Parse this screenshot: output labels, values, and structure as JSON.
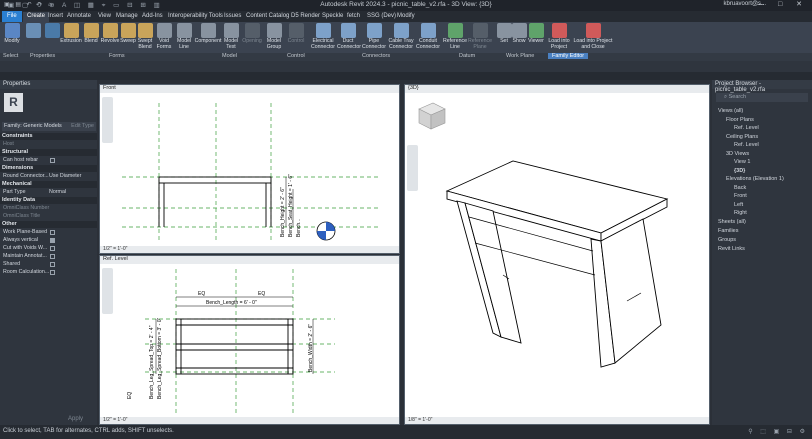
{
  "window": {
    "title": "Autodesk Revit 2024.3 - picnic_table_v2.rfa - 3D View: {3D}",
    "user": "kbruavoort@s...",
    "controls": "— □ ✕"
  },
  "tabs": [
    "File",
    "Create",
    "Insert",
    "Annotate",
    "View",
    "Manage",
    "Add-Ins",
    "Interoperability Tools",
    "Issues",
    "Content Catalog",
    "D5 Render",
    "Speckle",
    "fetch",
    "SSG (Dev)",
    "Modify"
  ],
  "ribbon": {
    "buttons": [
      "Modify",
      "Family Types",
      "Extrusion",
      "Blend",
      "Revolve",
      "Sweep",
      "Swept Blend",
      "Void Forms",
      "Model Line",
      "Component",
      "Model Text",
      "Opening",
      "Model Group",
      "Control",
      "Connector Ele",
      "Electrical Connector",
      "Duct Connector",
      "Pipe Connector",
      "Cable Tray Connector",
      "Conduit Connector",
      "Reference Line",
      "Reference Plane",
      "Set",
      "Show",
      "Viewer",
      "Load into Project",
      "Load into Project and Close"
    ],
    "panels": [
      "Select",
      "Properties",
      "Forms",
      "Model",
      "Control",
      "Connectors",
      "Datum",
      "Work Plane",
      "Family Editor"
    ]
  },
  "properties": {
    "header": "Properties",
    "logo": "R",
    "family": "Family: Generic Models",
    "edit_type": "Edit Type",
    "sections": [
      {
        "name": "Constraints",
        "rows": [
          {
            "label": "Host",
            "value": "",
            "dim": true
          }
        ]
      },
      {
        "name": "Structural",
        "rows": [
          {
            "label": "Can host rebar",
            "check": false
          }
        ]
      },
      {
        "name": "Dimensions",
        "rows": [
          {
            "label": "Round Connector...",
            "value": "Use Diameter"
          }
        ]
      },
      {
        "name": "Mechanical",
        "rows": [
          {
            "label": "Part Type",
            "value": "Normal"
          }
        ]
      },
      {
        "name": "Identity Data",
        "rows": [
          {
            "label": "OmniClass Number",
            "value": "",
            "dim": true
          },
          {
            "label": "OmniClass Title",
            "value": "",
            "dim": true
          }
        ]
      },
      {
        "name": "Other",
        "rows": [
          {
            "label": "Work Plane-Based",
            "check": false
          },
          {
            "label": "Always vertical",
            "check": true
          },
          {
            "label": "Cut with Voids W...",
            "check": false
          },
          {
            "label": "Maintain Annotat...",
            "check": false
          },
          {
            "label": "Shared",
            "check": false
          },
          {
            "label": "Room Calculation...",
            "check": false
          }
        ]
      }
    ],
    "apply": "Apply"
  },
  "views": {
    "front": {
      "title": "Front",
      "scale": "1/2\" = 1'-0\"",
      "dims": {
        "height": "Bench_Height = 2' - 6\"",
        "seat_height": "Bench_Seat_Height = 1' - 6\"",
        "offset": "Bench..."
      }
    },
    "plan": {
      "title": "Ref. Level",
      "scale": "1/2\" = 1'-0\"",
      "dims": {
        "length": "Bench_Length = 6' - 0\"",
        "eq": "EQ",
        "width": "Bench_Width = 2' - 6\"",
        "leg": "Bench_Leg_Spread_Top = 2' - 4\"",
        "leg_bottom": "Bench_Leg_Spread_Bottom = 3' - 0\""
      }
    },
    "three_d": {
      "title": "{3D}",
      "scale": "1/8\" = 1'-0\""
    }
  },
  "browser": {
    "header": "Project Browser - picnic_table_v2.rfa",
    "search": "Search",
    "items": [
      {
        "label": "Views (all)",
        "level": 0
      },
      {
        "label": "Floor Plans",
        "level": 1
      },
      {
        "label": "Ref. Level",
        "level": 2
      },
      {
        "label": "Ceiling Plans",
        "level": 1
      },
      {
        "label": "Ref. Level",
        "level": 2
      },
      {
        "label": "3D Views",
        "level": 1
      },
      {
        "label": "View 1",
        "level": 2
      },
      {
        "label": "{3D}",
        "level": 2,
        "bold": true
      },
      {
        "label": "Elevations (Elevation 1)",
        "level": 1
      },
      {
        "label": "Back",
        "level": 2
      },
      {
        "label": "Front",
        "level": 2
      },
      {
        "label": "Left",
        "level": 2
      },
      {
        "label": "Right",
        "level": 2
      },
      {
        "label": "Sheets (all)",
        "level": 0
      },
      {
        "label": "Families",
        "level": 0
      },
      {
        "label": "Groups",
        "level": 0
      },
      {
        "label": "Revit Links",
        "level": 0
      }
    ]
  },
  "status": "Click to select, TAB for alternates, CTRL adds, SHIFT unselects.",
  "colors": {
    "accent": "#2a7fd1",
    "dark": "#2b3038",
    "ribbon": "#3b4350"
  }
}
